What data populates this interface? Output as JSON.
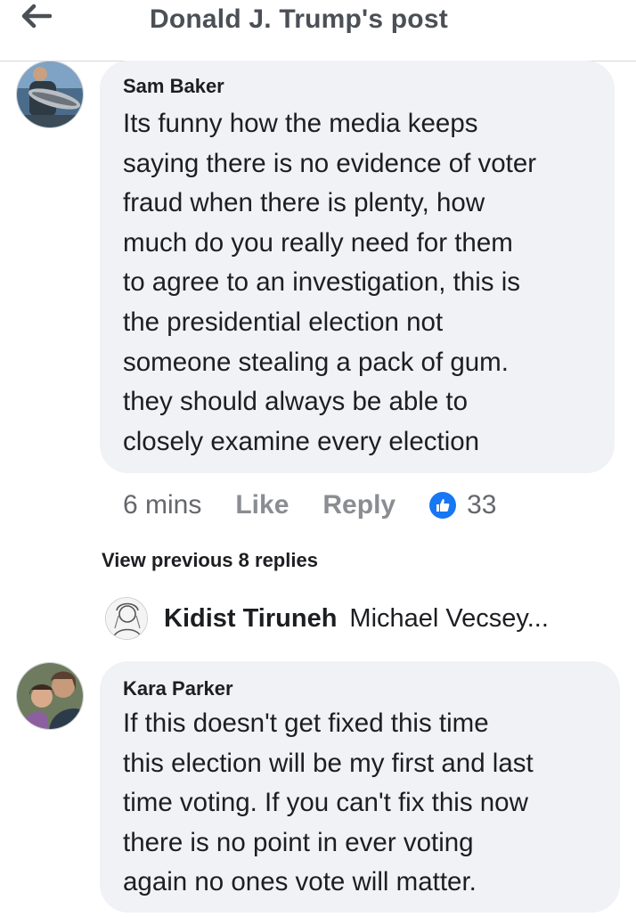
{
  "header": {
    "title": "Donald J. Trump's post",
    "back_icon": "back-arrow-icon"
  },
  "comments": [
    {
      "author": "Sam Baker",
      "lines": [
        "Its funny how the media keeps",
        "saying there is no evidence of voter",
        "fraud when there is plenty, how",
        "much do you really need for them",
        "to agree to an investigation, this is",
        "the presidential election not",
        "someone stealing a pack of gum.",
        "they should always be able to",
        "closely examine every election"
      ],
      "time": "6 mins",
      "like_label": "Like",
      "reply_label": "Reply",
      "reaction_icon": "like-thumb-icon",
      "reaction_count": "33"
    },
    {
      "author": "Kara Parker",
      "lines": [
        "If this doesn't get fixed this time",
        "this election will be my first and last",
        "time voting. If you can't fix this now",
        "there is no point in ever voting",
        "again no ones vote will matter."
      ]
    }
  ],
  "replies": {
    "view_previous_label": "View previous 8 replies",
    "latest": {
      "name": "Kidist Tiruneh",
      "snippet": "Michael Vecsey..."
    }
  },
  "colors": {
    "bubble": "#f0f2f5",
    "like_blue": "#1877f2",
    "muted_text": "#65676b",
    "header_title": "#4b4f56"
  }
}
